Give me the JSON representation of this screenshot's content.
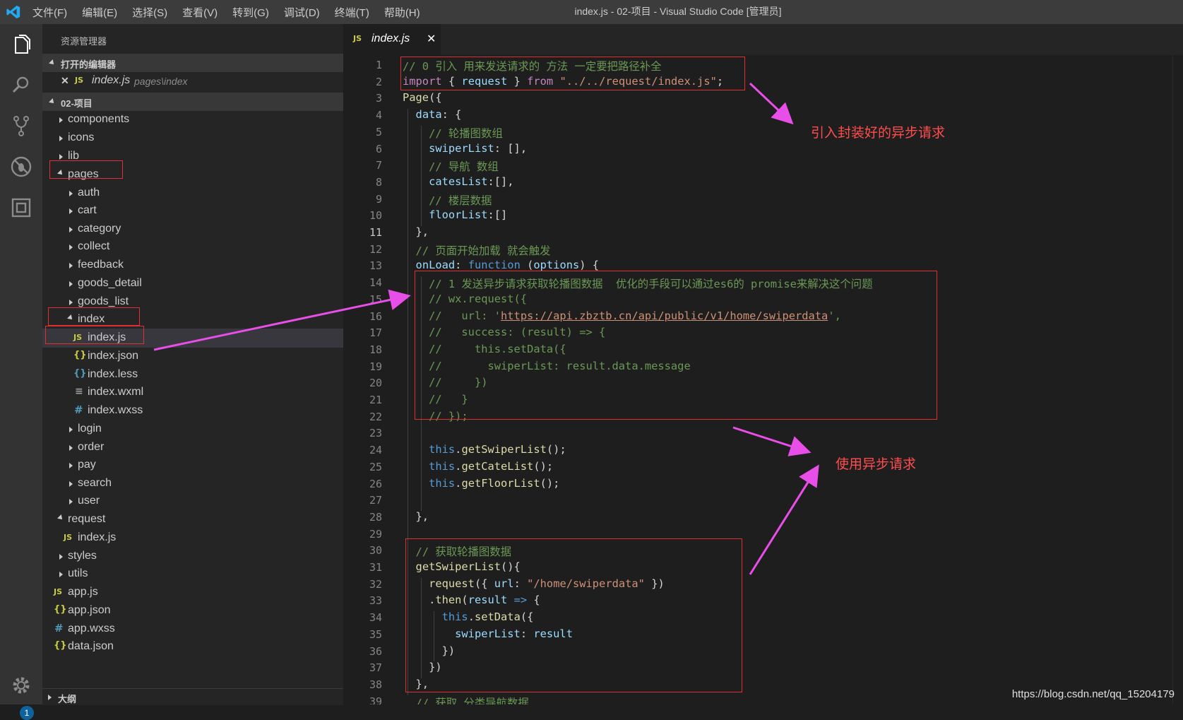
{
  "window": {
    "title": "index.js - 02-项目 - Visual Studio Code [管理员]"
  },
  "menu": [
    "文件(F)",
    "编辑(E)",
    "选择(S)",
    "查看(V)",
    "转到(G)",
    "调试(D)",
    "终端(T)",
    "帮助(H)"
  ],
  "activity_bar": {
    "settings_badge": "1"
  },
  "sidebar": {
    "title": "资源管理器",
    "open_editors_header": "打开的编辑器",
    "open_editor": {
      "name": "index.js",
      "path": "pages\\index",
      "close": "✕"
    },
    "project_header": "02-项目",
    "tree": [
      {
        "name": "components"
      },
      {
        "name": "icons"
      },
      {
        "name": "lib"
      },
      {
        "name": "pages"
      },
      {
        "name": "auth"
      },
      {
        "name": "cart"
      },
      {
        "name": "category"
      },
      {
        "name": "collect"
      },
      {
        "name": "feedback"
      },
      {
        "name": "goods_detail"
      },
      {
        "name": "goods_list"
      },
      {
        "name": "index"
      },
      {
        "name": "index.js"
      },
      {
        "name": "index.json"
      },
      {
        "name": "index.less"
      },
      {
        "name": "index.wxml"
      },
      {
        "name": "index.wxss"
      },
      {
        "name": "login"
      },
      {
        "name": "order"
      },
      {
        "name": "pay"
      },
      {
        "name": "search"
      },
      {
        "name": "user"
      },
      {
        "name": "request"
      },
      {
        "name": "index.js"
      },
      {
        "name": "styles"
      },
      {
        "name": "utils"
      },
      {
        "name": "app.js"
      },
      {
        "name": "app.json"
      },
      {
        "name": "app.wxss"
      },
      {
        "name": "data.json"
      }
    ],
    "outline_header": "大纲"
  },
  "tab": {
    "name": "index.js",
    "icon": "JS",
    "close": "✕"
  },
  "code_lines": [
    "// 0 引入 用来发送请求的 方法 一定要把路径补全",
    "import { request } from \"../../request/index.js\";",
    "Page({",
    "  data: {",
    "    // 轮播图数组",
    "    swiperList: [],",
    "    // 导航 数组",
    "    catesList:[],",
    "    // 楼层数据",
    "    floorList:[]",
    "  },",
    "  // 页面开始加载 就会触发",
    "  onLoad: function (options) {",
    "    // 1 发送异步请求获取轮播图数据  优化的手段可以通过es6的 promise来解决这个问题",
    "    // wx.request({",
    "    //   url: 'https://api.zbztb.cn/api/public/v1/home/swiperdata',",
    "    //   success: (result) => {",
    "    //     this.setData({",
    "    //       swiperList: result.data.message",
    "    //     })",
    "    //   }",
    "    // });",
    "",
    "    this.getSwiperList();",
    "    this.getCateList();",
    "    this.getFloorList();",
    "",
    "  },",
    "",
    "  // 获取轮播图数据",
    "  getSwiperList(){",
    "    request({ url: \"/home/swiperdata\" })",
    "    .then(result => {",
    "      this.setData({",
    "        swiperList: result",
    "      })",
    "    })",
    "  },",
    "  // 获取 分类导航数据"
  ],
  "current_line": 11,
  "annotations": {
    "import_note": "引入封装好的异步请求",
    "usage_note": "使用异步请求"
  },
  "watermark": "https://blog.csdn.net/qq_15204179",
  "colors": {
    "comment": "#6a9955",
    "keyword": "#c586c0",
    "string": "#ce9178",
    "annotation_red": "#e03030",
    "arrow_magenta": "#e84ee8"
  }
}
